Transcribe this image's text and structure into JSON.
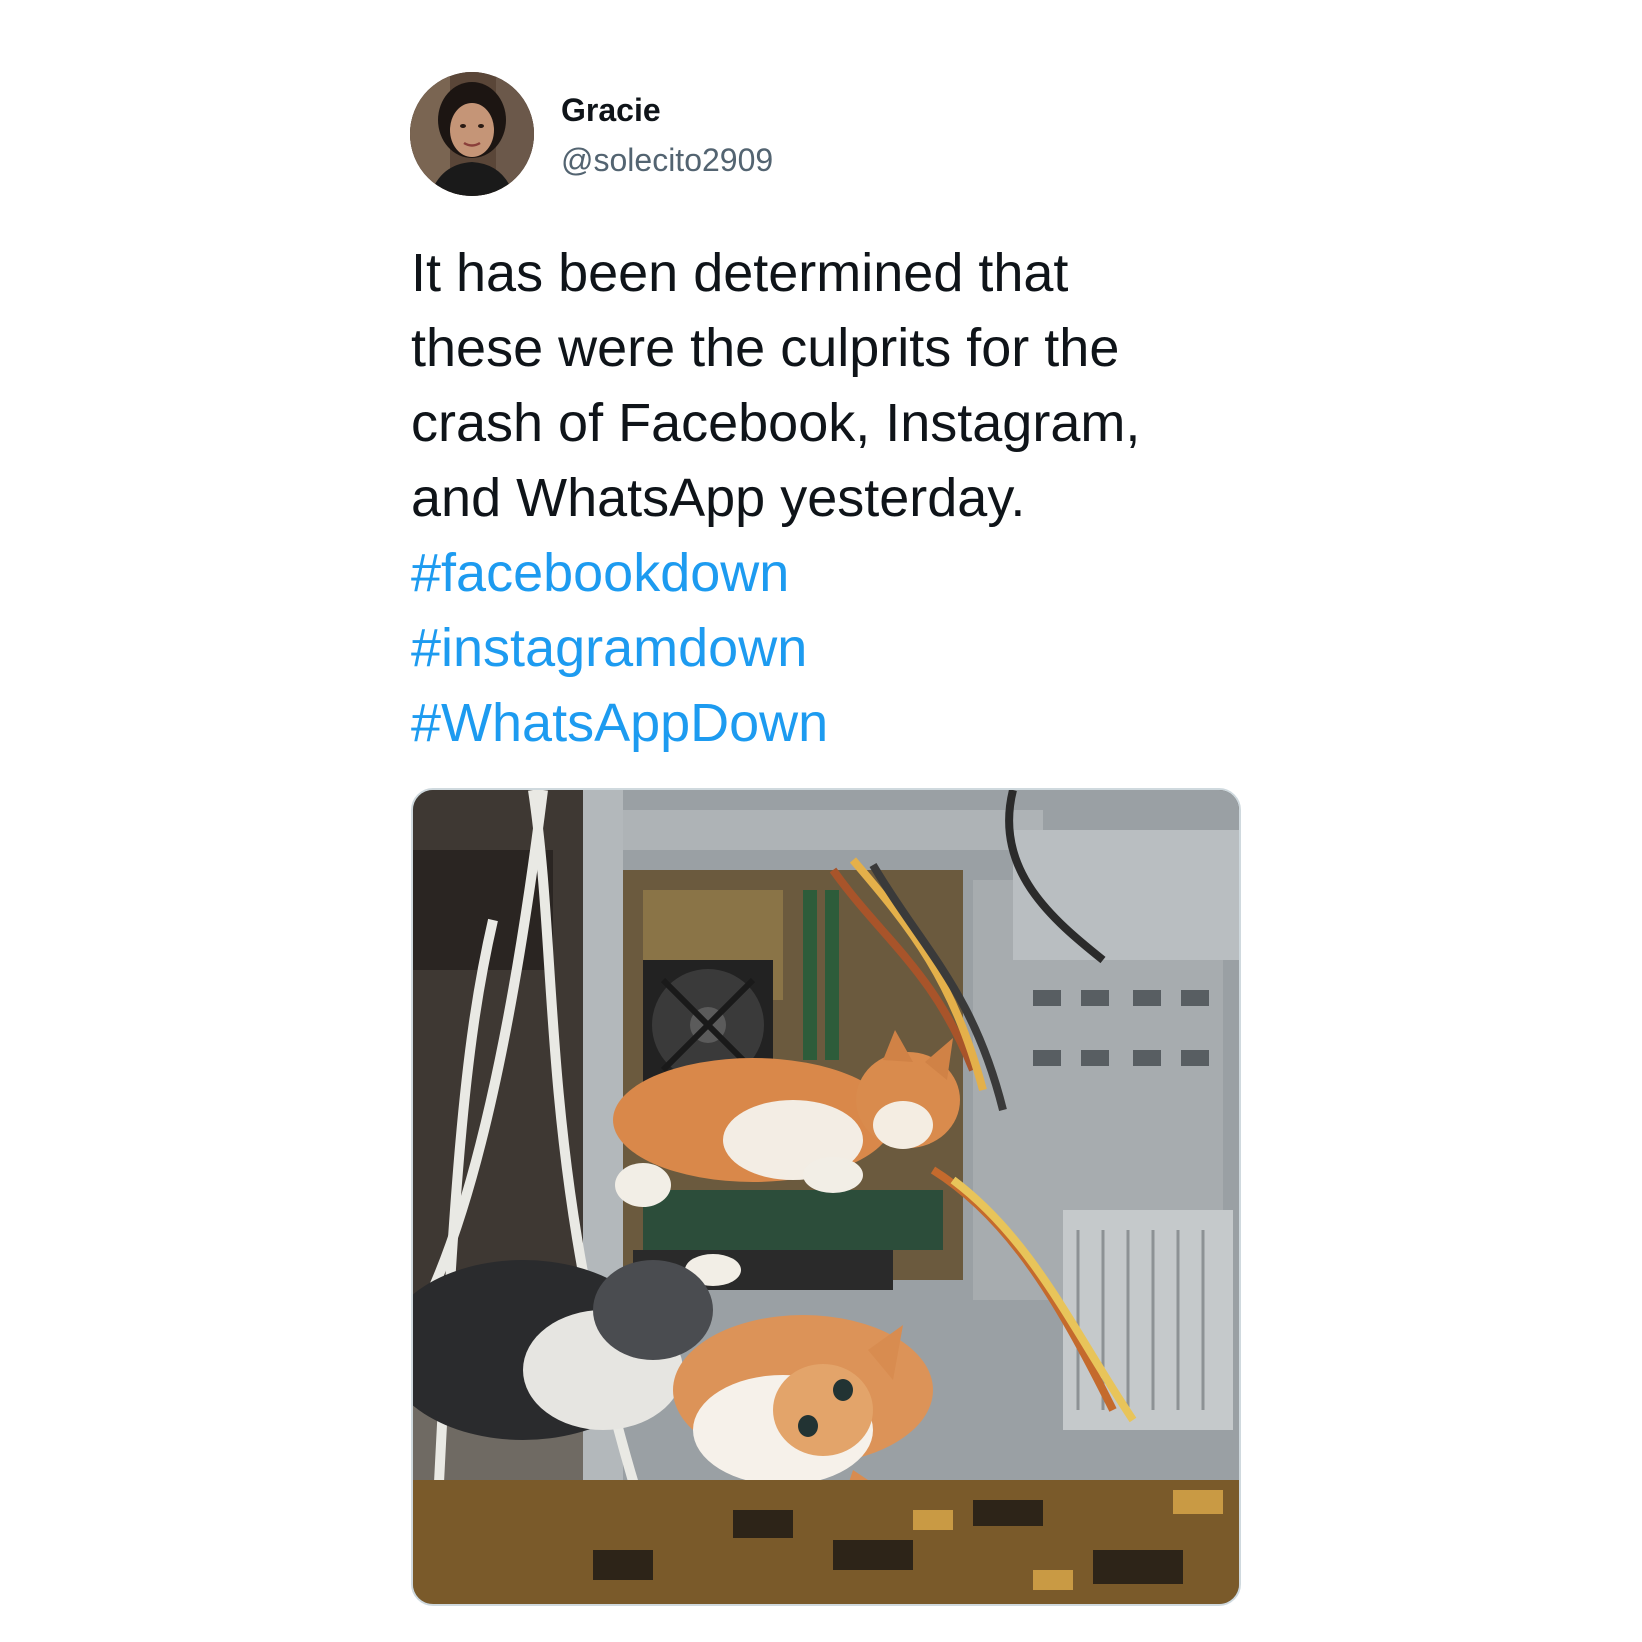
{
  "author": {
    "display_name": "Gracie",
    "handle": "@solecito2909"
  },
  "tweet": {
    "text_lines": [
      "It has been determined that",
      "these were the culprits for the",
      "crash of Facebook, Instagram,",
      "and WhatsApp yesterday."
    ],
    "hashtags": [
      "#facebookdown",
      "#instagramdown",
      "#WhatsAppDown"
    ]
  },
  "media": {
    "icon": "kittens-in-computer-case-photo"
  },
  "colors": {
    "text": "#0f1419",
    "secondary": "#536471",
    "link": "#1d9bf0",
    "border": "#cfd9de"
  }
}
